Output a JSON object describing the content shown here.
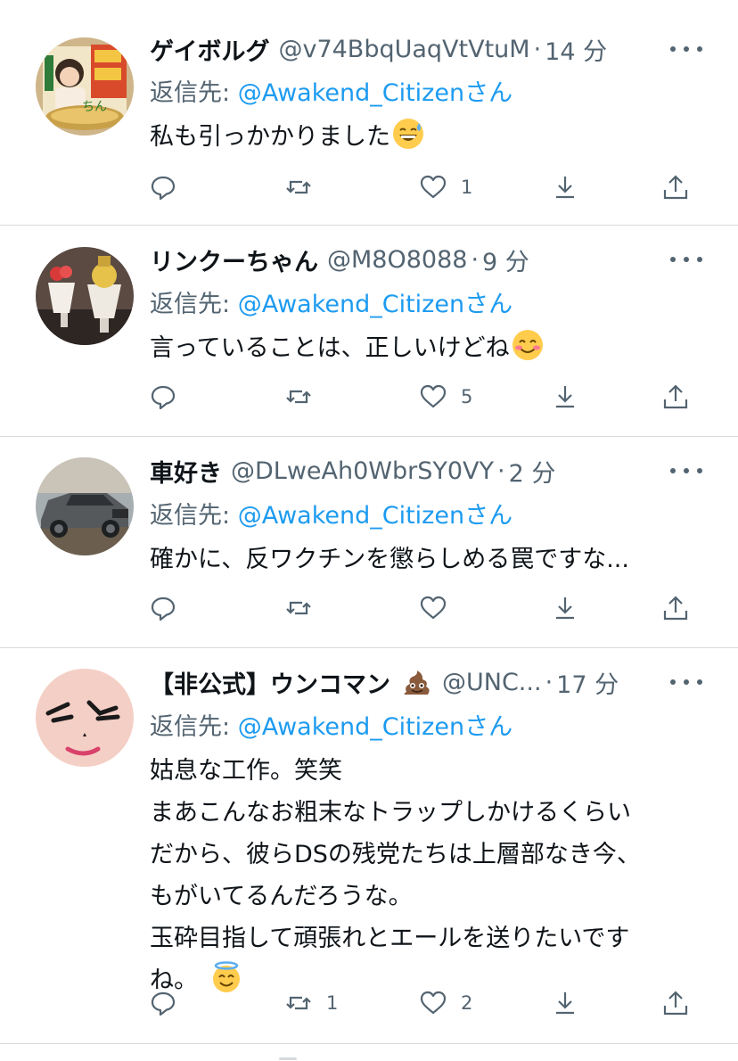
{
  "replying_to_label": "返信先:",
  "replying_to_handle": "@Awakend_Citizen",
  "replying_to_suffix": "さん",
  "sep": "·",
  "icons": {
    "reply": "reply-icon",
    "retweet": "retweet-icon",
    "like": "heart-icon",
    "bookmark": "download-icon",
    "share": "share-icon",
    "more": "more-icon"
  },
  "colors": {
    "link": "#1d9bf0",
    "muted": "#536471",
    "text": "#0f1419",
    "divider": "#d7dbdf"
  },
  "tweets": [
    {
      "name": "ゲイボルグ",
      "handle": "@v74BbqUaqVtVtuM",
      "time": "14 分",
      "lines": [
        "私も引っかかりました"
      ],
      "emoji": "sweat-smile-emoji",
      "retweets": "",
      "likes": "1"
    },
    {
      "name": "リンクーちゃん",
      "handle": "@M8O8088",
      "time": "9 分",
      "lines": [
        "言っていることは、正しいけどね"
      ],
      "emoji": "smiling-face-emoji",
      "retweets": "",
      "likes": "5"
    },
    {
      "name": "車好き",
      "handle": "@DLweAh0WbrSY0VY",
      "time": "2 分",
      "lines": [
        "確かに、反ワクチンを懲らしめる罠ですな..."
      ],
      "emoji": "",
      "retweets": "",
      "likes": ""
    },
    {
      "name": "【非公式】ウンコマン",
      "handle": "@UNC...",
      "time": "17 分",
      "lines": [
        "姑息な工作。笑笑",
        "まあこんなお粗末なトラップしかけるくらい",
        "だから、彼らDSの残党たちは上層部なき今、",
        "もがいてるんだろうな。",
        "玉砕目指して頑張れとエールを送りたいです",
        "ね。"
      ],
      "name_emoji": "poop-emoji",
      "emoji": "halo-smile-emoji",
      "retweets": "1",
      "likes": "2"
    }
  ]
}
